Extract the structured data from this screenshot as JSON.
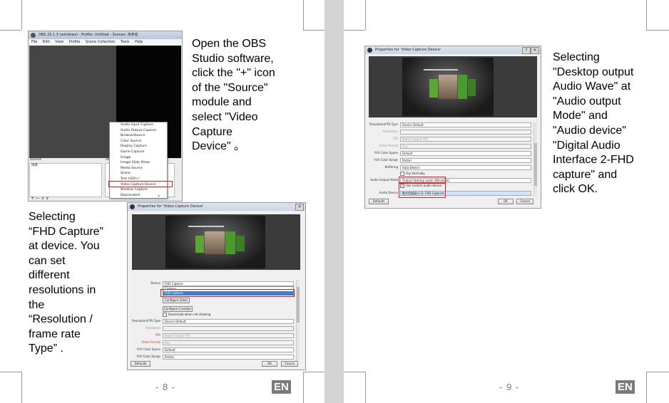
{
  "left_page": {
    "intro_text": "Open the OBS\nStudio software,\nclick the \"+\" icon\nof the \"Source\"\nmodule and\nselect \"Video\nCapture\nDevice\"  。",
    "device_text": "Selecting\n“FHD Capture”\nat device. You\ncan set\ndifferent\nresolutions in\nthe\n“Resolution /\nframe rate\nType” .",
    "page_number": "- 8 -",
    "lang_badge": "EN"
  },
  "right_page": {
    "audio_text": "Selecting\n\"Desktop output\nAudio Wave\" at\n\"Audio output\nMode\" and\n\"Audio device\"\n\"Digital Audio\nInterface 2-FHD\ncapture\" and\nclick OK.",
    "page_number": "- 9 -",
    "lang_badge": "EN"
  },
  "obs_window": {
    "title": "OBS 20.1.3 (windows) - Profile: Untitled - Scenes: 未命名",
    "menu": [
      "File",
      "Edit",
      "View",
      "Profile",
      "Scene Collection",
      "Tools",
      "Help"
    ],
    "scenes_header": "Scenes",
    "scene_item": "场景",
    "sources_header": "Sources",
    "dock_controls": "+ — ∧ ∨",
    "source_menu": [
      "Audio Input Capture",
      "Audio Output Capture",
      "BrowserSource",
      "Color Source",
      "Display Capture",
      "Game Capture",
      "Image",
      "Image Slide Show",
      "Media Source",
      "Scene",
      "Text (GDI+)",
      "Video Capture Device",
      "Window Capture",
      "Deprecated"
    ],
    "highlighted_item": "Video Capture Device"
  },
  "dialog_device": {
    "title": "Properties for 'Video Capture Device'",
    "device_label": "Device",
    "device_value": "FHD Capture",
    "dropdown_options": [
      "Camera",
      "FHD Capture"
    ],
    "configure_video": "Configure Video",
    "configure_crossbar": "Configure Crossbar",
    "deactivate_label": "Deactivate when not showing",
    "resolution_label": "Resolution/FPS Type",
    "resolution_value": "Device Default",
    "res_label": "Resolution",
    "fps_label": "FPS",
    "fps_value": "Match Output FPS",
    "video_format_label": "Video Format",
    "video_format_value": "Any",
    "color_space_label": "YUV Color Space",
    "color_space_value": "Default",
    "color_range_label": "YUV Color Range",
    "color_range_value": "Partial",
    "defaults_button": "Defaults",
    "ok_button": "OK",
    "cancel_button": "Cancel"
  },
  "dialog_audio": {
    "title": "Properties for 'Video Capture Device'",
    "resolution_label": "Resolution/FPS Type",
    "resolution_value": "Device Default",
    "res_label": "Resolution",
    "fps_label": "FPS",
    "fps_value": "Match Output FPS",
    "video_format_label": "Video Format",
    "video_format_value": "Any",
    "color_space_label": "YUV Color Space",
    "color_space_value": "Default",
    "color_range_label": "YUV Color Range",
    "color_range_value": "Partial",
    "buffering_label": "Buffering",
    "buffering_value": "Auto-Detect",
    "flip_label": "Flip Vertically",
    "audio_mode_label": "Audio Output Mode",
    "audio_mode_value": "Output desktop audio (WaveOut)",
    "custom_audio_label": "Use custom audio device",
    "audio_device_label": "Audio Device",
    "audio_device_value": "数字音频接口 (2- FHD Capture)",
    "defaults_button": "Defaults",
    "ok_button": "OK",
    "cancel_button": "Cancel"
  },
  "colors": {
    "highlight_red": "#e02020",
    "selection_blue": "#3c7fd6",
    "badge_gray": "#7a7a7a",
    "tile_green": "#5aa832"
  }
}
